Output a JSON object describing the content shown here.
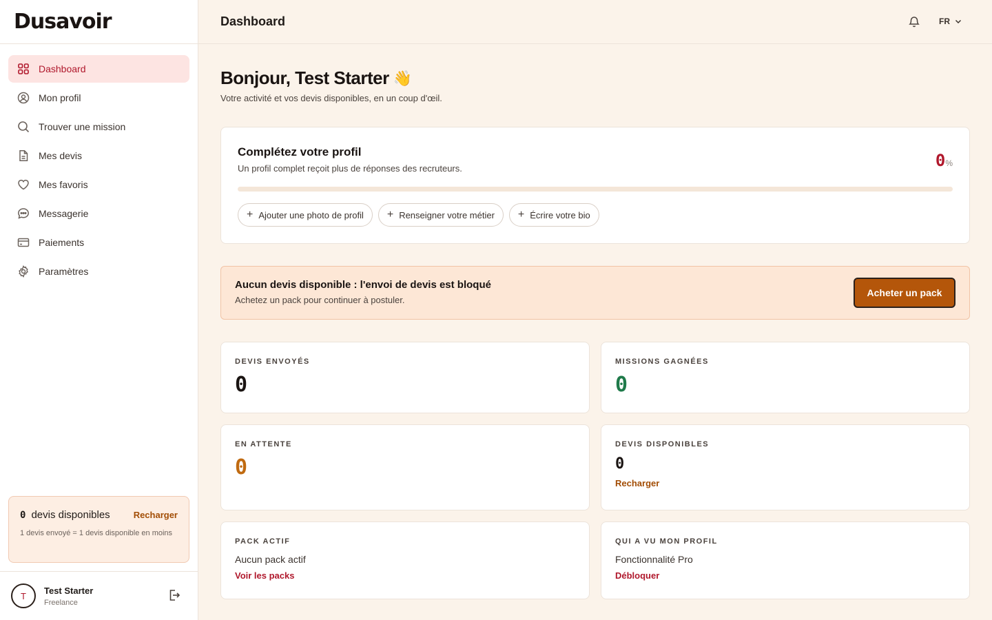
{
  "brand": {
    "logo_text": "Dusavoir"
  },
  "sidebar": {
    "items": [
      {
        "label": "Dashboard",
        "icon": "grid-icon",
        "active": true
      },
      {
        "label": "Mon profil",
        "icon": "user-circle-icon"
      },
      {
        "label": "Trouver une mission",
        "icon": "search-icon"
      },
      {
        "label": "Mes devis",
        "icon": "document-icon"
      },
      {
        "label": "Mes favoris",
        "icon": "heart-icon"
      },
      {
        "label": "Messagerie",
        "icon": "chat-icon"
      },
      {
        "label": "Paiements",
        "icon": "credit-card-icon"
      },
      {
        "label": "Paramètres",
        "icon": "gear-icon"
      }
    ],
    "credits": {
      "count": "0",
      "label": "devis disponibles",
      "link": "Recharger",
      "note": "1 devis envoyé = 1 devis disponible en moins"
    },
    "user": {
      "initial": "T",
      "name": "Test Starter",
      "role": "Freelance"
    }
  },
  "header": {
    "title": "Dashboard",
    "lang": "FR"
  },
  "main": {
    "greeting": "Bonjour, Test Starter",
    "greeting_emoji": "👋",
    "subtitle": "Votre activité et vos devis disponibles, en un coup d'œil.",
    "profile": {
      "title": "Complétez votre profil",
      "subtitle": "Un profil complet reçoit plus de réponses des recruteurs.",
      "percent": "0",
      "percent_unit": "%",
      "progress": 0,
      "chips": [
        "Ajouter une photo de profil",
        "Renseigner votre métier",
        "Écrire votre bio"
      ]
    },
    "alert": {
      "title": "Aucun devis disponible : l'envoi de devis est bloqué",
      "subtitle": "Achetez un pack pour continuer à postuler.",
      "button": "Acheter un pack"
    },
    "stats": {
      "sent": {
        "label": "DEVIS ENVOYÉS",
        "value": "0"
      },
      "won": {
        "label": "MISSIONS GAGNÉES",
        "value": "0"
      },
      "pending": {
        "label": "EN ATTENTE",
        "value": "0"
      },
      "available": {
        "label": "DEVIS DISPONIBLES",
        "value": "0",
        "link": "Recharger"
      },
      "pack": {
        "label": "PACK ACTIF",
        "text": "Aucun pack actif",
        "link": "Voir les packs"
      },
      "views": {
        "label": "QUI A VU MON PROFIL",
        "text": "Fonctionnalité Pro",
        "link": "Débloquer"
      }
    }
  },
  "colors": {
    "accent": "#b0182c",
    "won": "#1f7a4a",
    "pending": "#c06a10",
    "button": "#b4560a",
    "link_orange": "#a24d05"
  }
}
